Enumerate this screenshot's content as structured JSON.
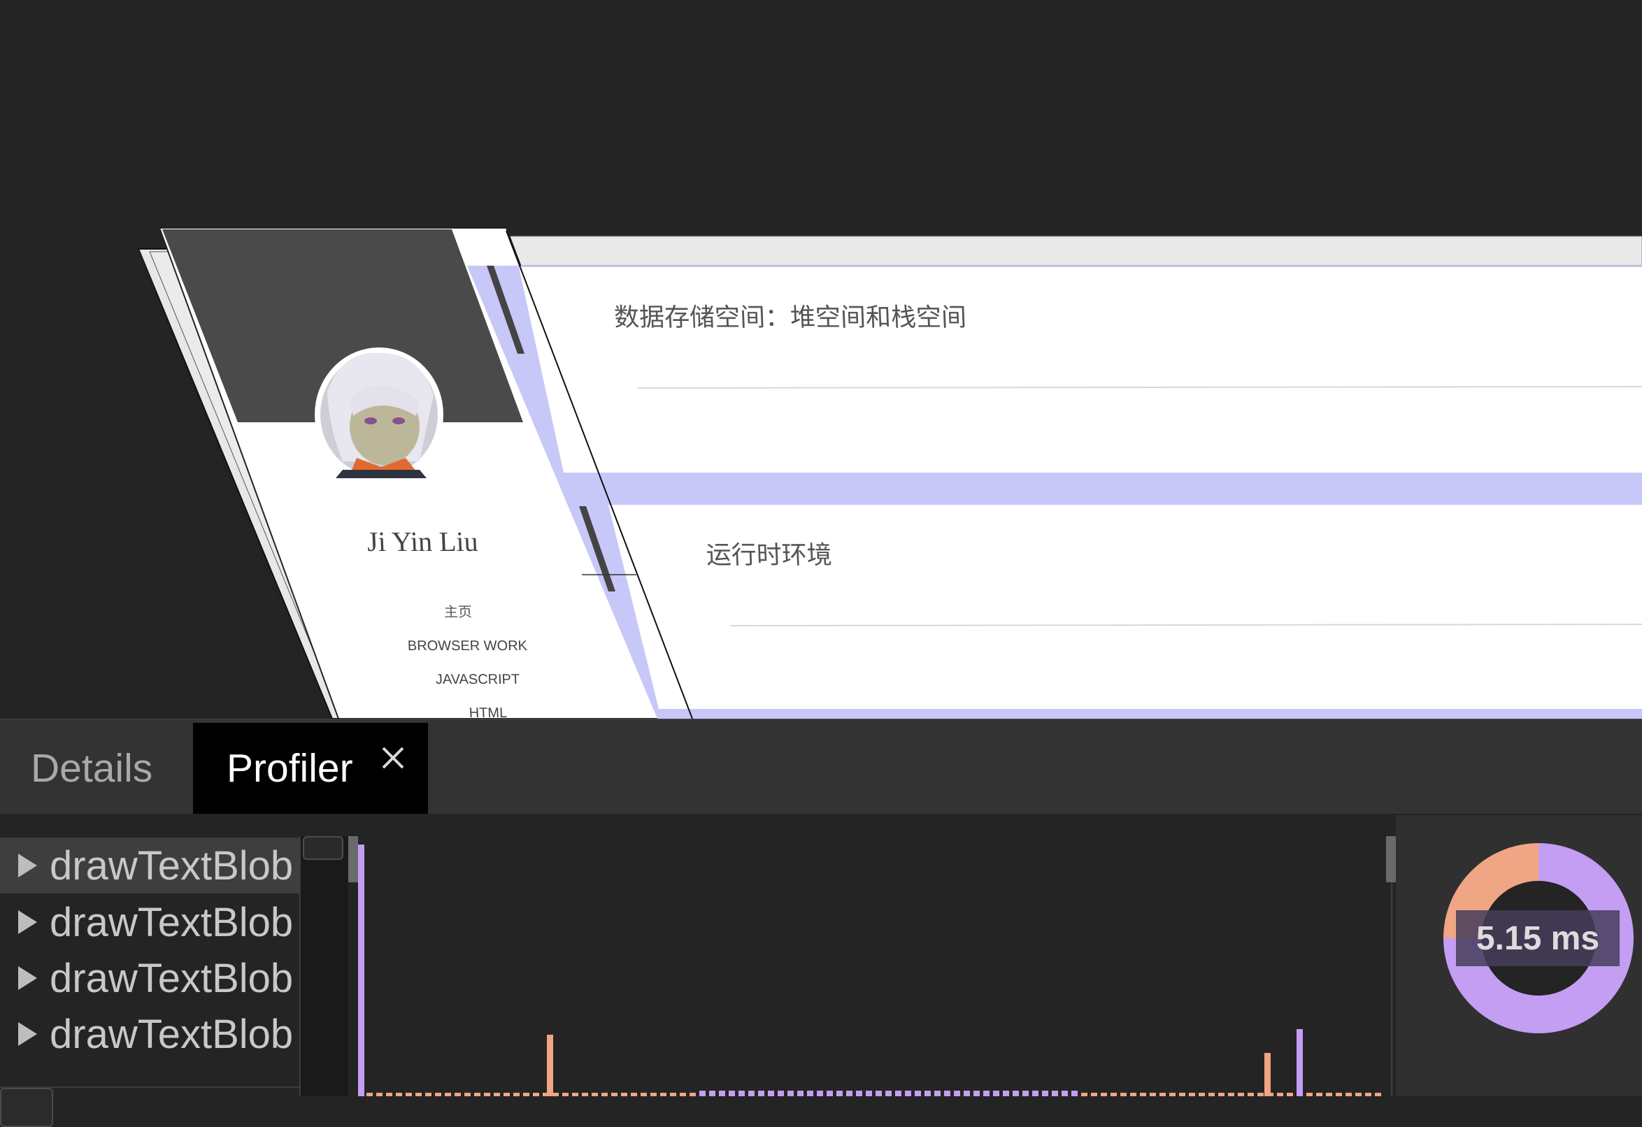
{
  "viewport": {
    "page": {
      "profile_name": "Ji Yin Liu",
      "nav_items": [
        "主页",
        "BROWSER WORK",
        "JAVASCRIPT",
        "HTML"
      ],
      "cards": [
        {
          "title": "数据存储空间：堆空间和栈空间"
        },
        {
          "title": "运行时环境"
        }
      ]
    }
  },
  "tabs": {
    "details": "Details",
    "profiler": "Profiler"
  },
  "call_list": {
    "items": [
      "drawTextBlob",
      "drawTextBlob",
      "drawTextBlob",
      "drawTextBlob"
    ],
    "selected_index": 0
  },
  "donut": {
    "label": "5.15 ms",
    "segments": [
      {
        "name": "purple",
        "color": "#c39ef2",
        "fraction": 0.75
      },
      {
        "name": "orange",
        "color": "#f0a585",
        "fraction": 0.25
      }
    ]
  },
  "colors": {
    "purple": "#c39ef2",
    "orange": "#f0a585",
    "layer_blue": "#c7c8f7"
  }
}
